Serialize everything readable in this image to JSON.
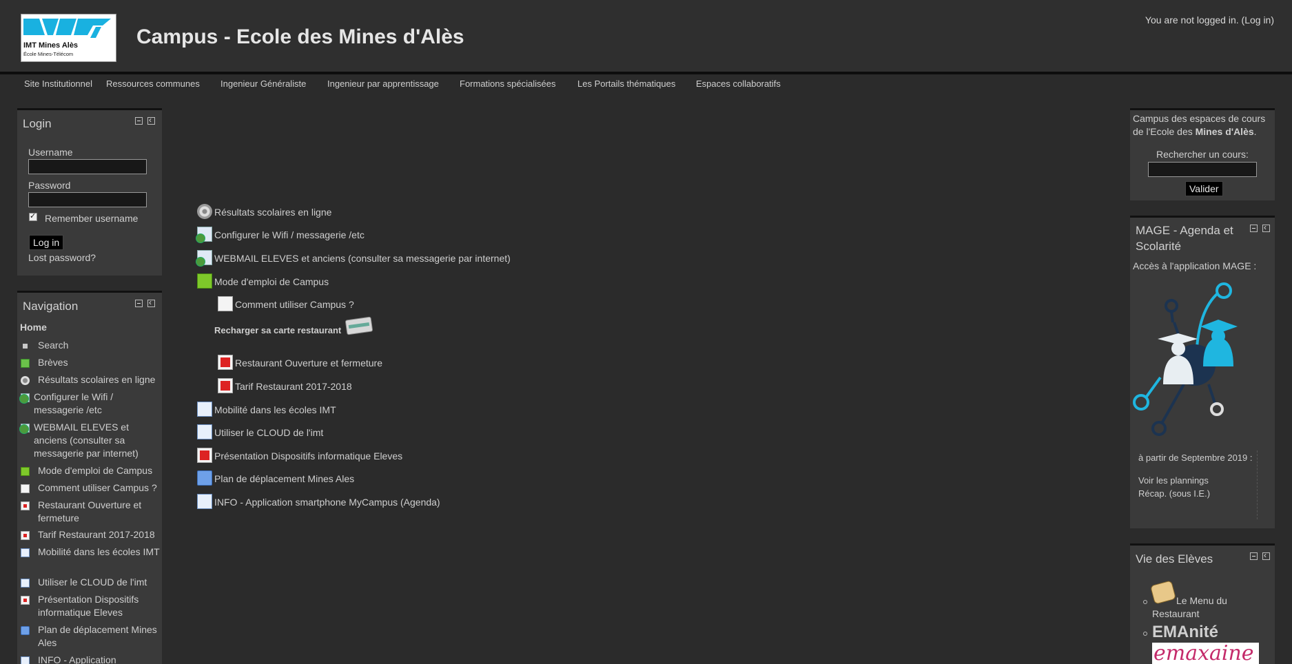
{
  "header": {
    "site_title": "Campus - Ecole des Mines d'Alès",
    "logo_name": "IMT Mines Alès",
    "logo_sub": "École Mines-Télécom",
    "login_status_prefix": "You are not logged in. ",
    "login_link": "(Log in)"
  },
  "topnav": [
    "Site Institutionnel",
    "Ressources communes",
    "Ingenieur Généraliste",
    "Ingenieur par apprentissage",
    "Formations spécialisées",
    "Les Portails thématiques",
    "Espaces collaboratifs"
  ],
  "login_block": {
    "title": "Login",
    "username_label": "Username",
    "password_label": "Password",
    "remember_label": "Remember username",
    "login_button": "Log in",
    "lost_password": "Lost password?"
  },
  "navigation_block": {
    "title": "Navigation",
    "home": "Home",
    "items": [
      {
        "label": "Search",
        "icon": "square-bullet-icon"
      },
      {
        "label": "Brèves",
        "icon": "forum-icon"
      },
      {
        "label": "Résultats scolaires en ligne",
        "icon": "gear-icon"
      },
      {
        "label": "Configurer le Wifi / messagerie /etc",
        "icon": "url-icon"
      },
      {
        "label": "WEBMAIL ELEVES et anciens (consulter sa messagerie par internet)",
        "icon": "url-icon"
      },
      {
        "label": "Mode d'emploi de Campus",
        "icon": "book-icon"
      },
      {
        "label": "Comment utiliser Campus ?",
        "icon": "page-icon"
      },
      {
        "label": "Restaurant Ouverture et fermeture",
        "icon": "pdf-icon"
      },
      {
        "label": "Tarif Restaurant 2017-2018",
        "icon": "pdf-icon"
      },
      {
        "label": "Mobilité dans les écoles IMT",
        "icon": "document-icon"
      },
      {
        "label": "Utiliser le CLOUD de l'imt",
        "icon": "document-icon"
      },
      {
        "label": "Présentation Dispositifs informatique Eleves",
        "icon": "pdf-icon"
      },
      {
        "label": "Plan de déplacement Mines Ales",
        "icon": "folder-icon"
      },
      {
        "label": "INFO - Application",
        "icon": "document-icon"
      }
    ]
  },
  "main": {
    "items": [
      {
        "label": "Résultats scolaires en ligne",
        "icon": "gear-icon"
      },
      {
        "label": "Configurer le Wifi / messagerie /etc",
        "icon": "url-icon"
      },
      {
        "label": "WEBMAIL ELEVES et anciens (consulter sa messagerie par internet)",
        "icon": "url-icon"
      },
      {
        "label": "Mode d'emploi de Campus",
        "icon": "book-icon"
      },
      {
        "label": "Comment utiliser Campus ?",
        "icon": "page-icon"
      },
      {
        "label": "Recharger sa carte restaurant",
        "icon": "credit-card-icon"
      },
      {
        "label": "Restaurant Ouverture et fermeture",
        "icon": "pdf-icon"
      },
      {
        "label": "Tarif Restaurant 2017-2018",
        "icon": "pdf-icon"
      },
      {
        "label": "Mobilité dans les écoles IMT",
        "icon": "document-icon"
      },
      {
        "label": "Utiliser le CLOUD de l'imt",
        "icon": "document-icon"
      },
      {
        "label": "Présentation Dispositifs informatique Eleves",
        "icon": "pdf-icon"
      },
      {
        "label": "Plan de déplacement Mines Ales",
        "icon": "folder-icon"
      },
      {
        "label": "INFO - Application smartphone MyCampus (Agenda)",
        "icon": "document-icon"
      }
    ]
  },
  "search_block": {
    "intro_line1": "Campus des espaces de cours",
    "intro_line2_prefix": "de l'Ecole des ",
    "intro_bold": "Mines d'Alès",
    "intro_suffix": ".",
    "search_label": "Rechercher un cours:",
    "submit_button": "Valider"
  },
  "mage_block": {
    "title_line1": "MAGE - Agenda et",
    "title_line2": "Scolarité",
    "access_text": "Accès à l'application MAGE :",
    "date_text": "à partir de Septembre 2019 :",
    "link1": "Voir les plannings",
    "link2": "Récap. (sous I.E.)"
  },
  "vie_block": {
    "title": "Vie des Elèves",
    "menu_label_line1": "Le Menu du",
    "menu_label_line2": "Restaurant",
    "emanite": "EMAnité",
    "emanite_logo_text": "emaxaine"
  },
  "colors": {
    "background": "#2b2b2b",
    "block": "#3a3a3a",
    "accent_cyan": "#1fb6e0",
    "navy": "#1c3350"
  }
}
